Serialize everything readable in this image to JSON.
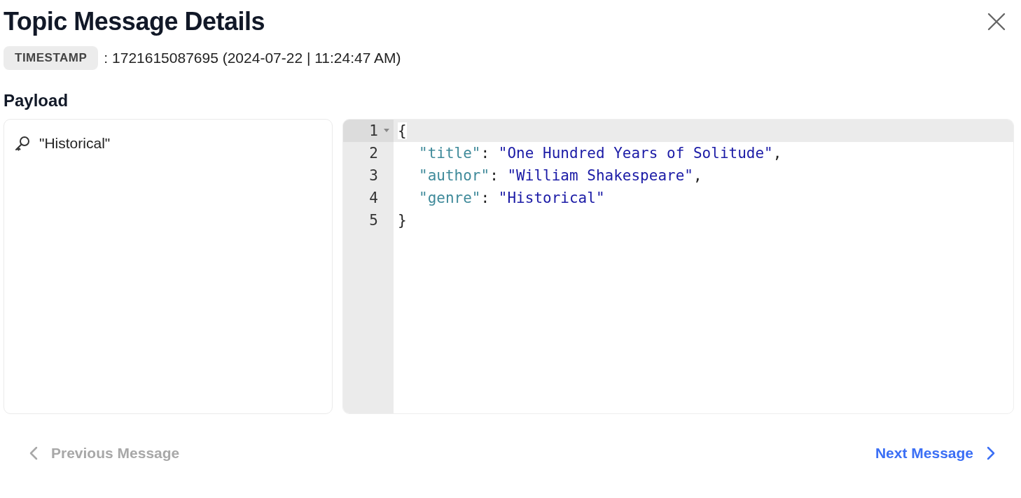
{
  "dialog": {
    "title": "Topic Message Details"
  },
  "timestamp": {
    "label": "TIMESTAMP",
    "value": ": 1721615087695 (2024-07-22 | 11:24:47 AM)"
  },
  "payload": {
    "label": "Payload",
    "key": "\"Historical\"",
    "editor": {
      "lines": [
        {
          "number": "1",
          "kind": "open",
          "active": true,
          "foldable": true,
          "tokens": [
            {
              "kind": "bracket",
              "text": "{"
            }
          ]
        },
        {
          "number": "2",
          "kind": "entry",
          "active": false,
          "foldable": false,
          "tokens": [
            {
              "kind": "key",
              "text": "\"title\""
            },
            {
              "kind": "punct",
              "text": ": "
            },
            {
              "kind": "string",
              "text": "\"One Hundred Years of Solitude\""
            },
            {
              "kind": "punct",
              "text": ","
            }
          ]
        },
        {
          "number": "3",
          "kind": "entry",
          "active": false,
          "foldable": false,
          "tokens": [
            {
              "kind": "key",
              "text": "\"author\""
            },
            {
              "kind": "punct",
              "text": ": "
            },
            {
              "kind": "string",
              "text": "\"William Shakespeare\""
            },
            {
              "kind": "punct",
              "text": ","
            }
          ]
        },
        {
          "number": "4",
          "kind": "entry",
          "active": false,
          "foldable": false,
          "tokens": [
            {
              "kind": "key",
              "text": "\"genre\""
            },
            {
              "kind": "punct",
              "text": ": "
            },
            {
              "kind": "string",
              "text": "\"Historical\""
            }
          ]
        },
        {
          "number": "5",
          "kind": "close",
          "active": false,
          "foldable": false,
          "tokens": [
            {
              "kind": "bracket",
              "text": "}"
            }
          ]
        }
      ]
    }
  },
  "navigation": [
    {
      "kind": "previous",
      "label": "Previous Message",
      "disabled": true
    },
    {
      "kind": "next",
      "label": "Next Message",
      "disabled": false
    }
  ]
}
